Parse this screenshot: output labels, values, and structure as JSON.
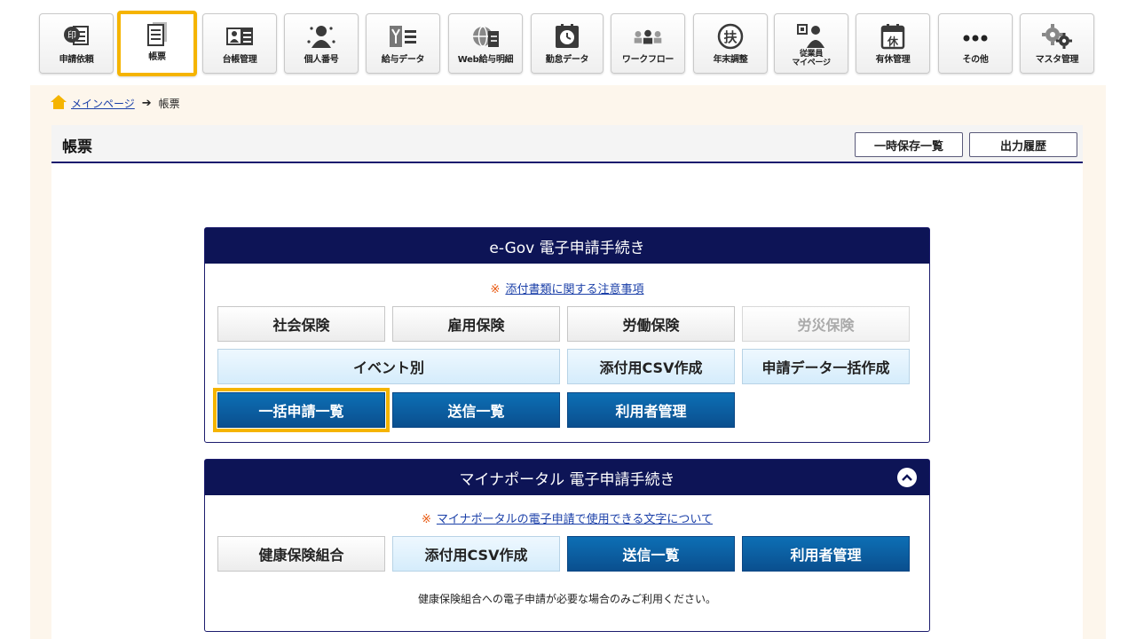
{
  "toolbar": {
    "items": [
      {
        "label": "申請依頼",
        "icon": "stamp-document-icon"
      },
      {
        "label": "帳票",
        "icon": "form-sheet-icon"
      },
      {
        "label": "台帳管理",
        "icon": "ledger-person-icon"
      },
      {
        "label": "個人番号",
        "icon": "personal-number-icon"
      },
      {
        "label": "給与データ",
        "icon": "payroll-data-icon"
      },
      {
        "label": "Web給与明細",
        "icon": "web-payslip-icon"
      },
      {
        "label": "勤怠データ",
        "icon": "attendance-clock-icon"
      },
      {
        "label": "ワークフロー",
        "icon": "workflow-people-icon"
      },
      {
        "label": "年末調整",
        "icon": "year-end-adjustment-icon"
      },
      {
        "label": "従業員\nマイページ",
        "icon": "employee-mypage-icon"
      },
      {
        "label": "有休管理",
        "icon": "paid-leave-calendar-icon"
      },
      {
        "label": "その他",
        "icon": "more-dots-icon"
      },
      {
        "label": "マスタ管理",
        "icon": "gear-icon"
      }
    ],
    "active_index": 1,
    "icon_glyphs": {
      "stamp": "印",
      "leave": "休",
      "fu": "扶"
    },
    "colors": {
      "icon": "#3a3a3a",
      "accent": "#f5b400"
    }
  },
  "breadcrumb": {
    "home": "メインページ",
    "current": "帳票"
  },
  "page": {
    "title": "帳票",
    "temp_save_list": "一時保存一覧",
    "output_history": "出力履歴"
  },
  "egov": {
    "title": "e-Gov 電子申請手続き",
    "note_mark": "※",
    "note_link": "添付書類に関する注意事項",
    "buttons": {
      "social_insurance": "社会保険",
      "employment_insurance": "雇用保険",
      "labor_insurance": "労働保険",
      "workers_comp": "労災保険",
      "by_event": "イベント別",
      "attach_csv": "添付用CSV作成",
      "bulk_create": "申請データ一括作成",
      "bulk_list": "一括申請一覧",
      "send_list": "送信一覧",
      "user_mgmt": "利用者管理"
    }
  },
  "mynaportal": {
    "title": "マイナポータル 電子申請手続き",
    "note_mark": "※",
    "note_link": "マイナポータルの電子申請で使用できる文字について",
    "buttons": {
      "health_union": "健康保険組合",
      "attach_csv": "添付用CSV作成",
      "send_list": "送信一覧",
      "user_mgmt": "利用者管理"
    },
    "footer": "健康保険組合への電子申請が必要な場合のみご利用ください。"
  }
}
